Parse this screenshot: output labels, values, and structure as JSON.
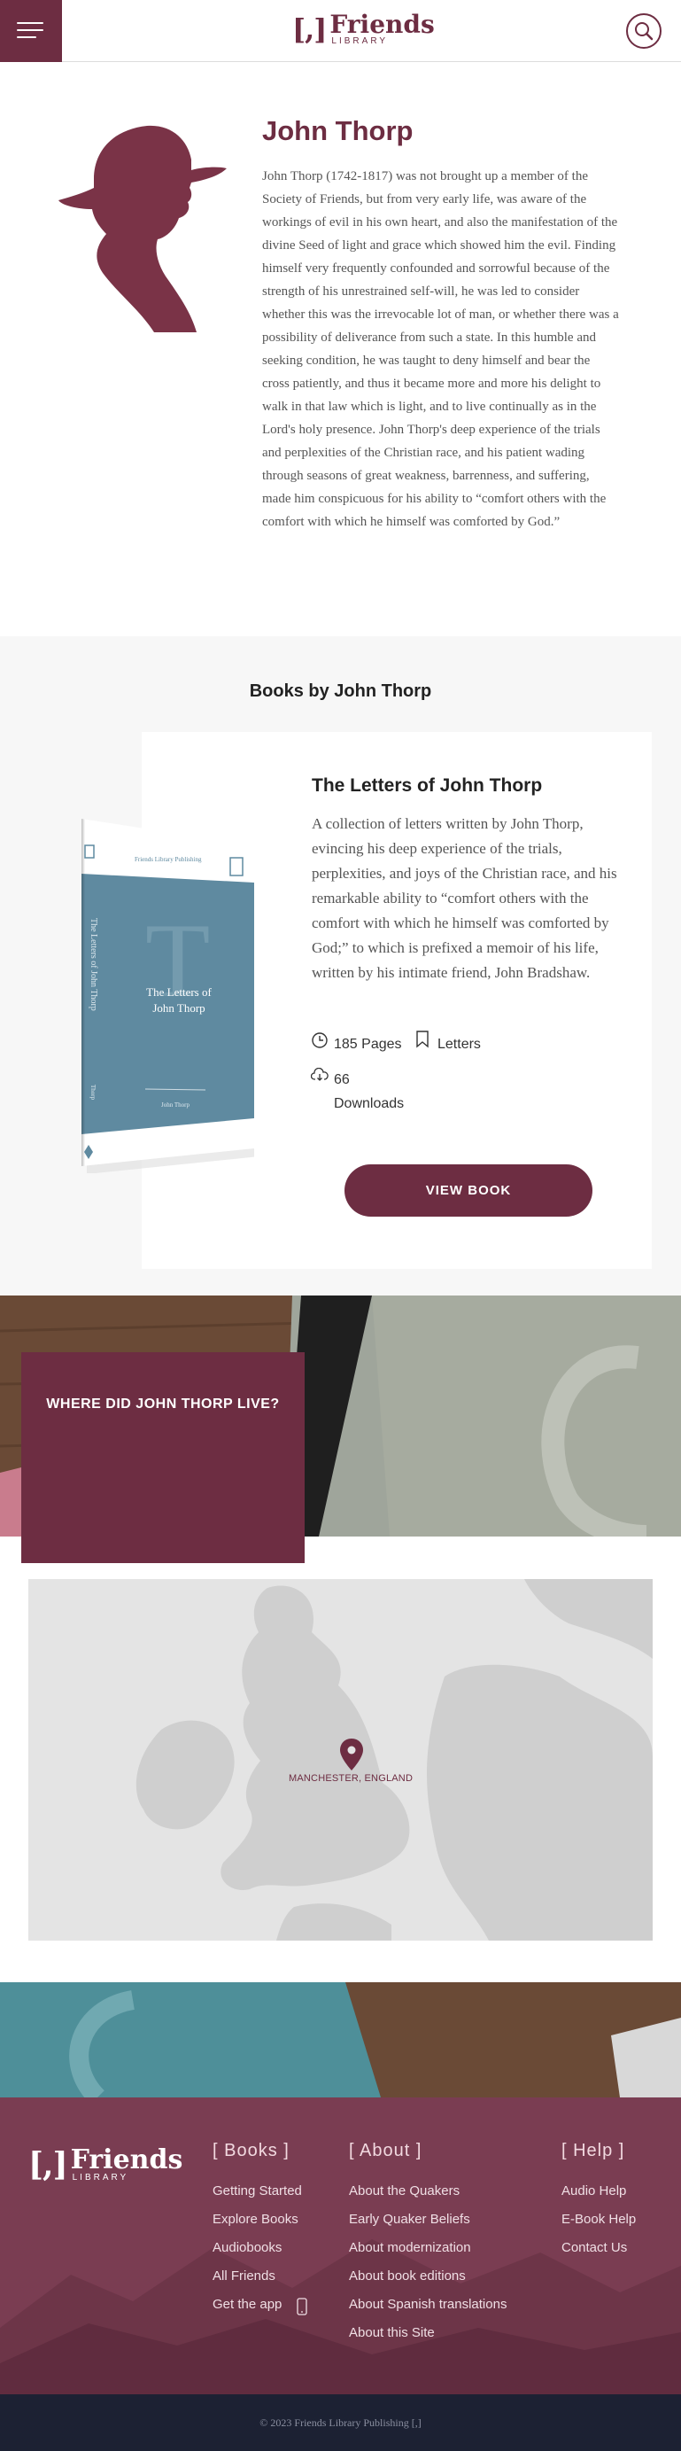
{
  "header": {
    "logo_mark": "[,]",
    "logo_word": "Friends",
    "logo_sub": "LIBRARY",
    "menu_icon": "hamburger-icon",
    "search_icon": "search-icon"
  },
  "author": {
    "name": "John Thorp",
    "bio": "John Thorp (1742-1817) was not brought up a member of the Society of Friends, but from very early life, was aware of the workings of evil in his own heart, and also the manifestation of the divine Seed of light and grace which showed him the evil. Finding himself very frequently confounded and sorrowful because of the strength of his unrestrained self-will, he was led to consider whether this was the irrevocable lot of man, or whether there was a possibility of deliverance from such a state. In this humble and seeking condition, he was taught to deny himself and bear the cross patiently, and thus it became more and more his delight to walk in that law which is light, and to live continually as in the Lord's holy presence. John Thorp's deep experience of the trials and perplexities of the Christian race, and his patient wading through seasons of great weakness, barrenness, and suffering, made him conspicuous for his ability to “comfort others with the comfort with which he himself was comforted by God.”"
  },
  "books": {
    "heading": "Books by John Thorp",
    "items": [
      {
        "title": "The Letters of John Thorp",
        "description": "A collection of letters written by John Thorp, evincing his deep experience of the trials, perplexities, and joys of the Christian race, and his remarkable ability to “comfort others with the comfort with which he himself was comforted by God;” to which is prefixed a memoir of his life, written by his intimate friend, John Bradshaw.",
        "pages": "185 Pages",
        "tag": "Letters",
        "downloads_count": "66",
        "downloads_label": "Downloads",
        "button": "VIEW BOOK",
        "cover": {
          "publisher": "Friends Library Publishing",
          "title_line1": "The Letters of",
          "title_line2": "John Thorp",
          "spine": "The Letters of John Thorp",
          "author": "John Thorp",
          "spine_author": "Thorp",
          "letter": "T",
          "color": "#5f8aa0"
        }
      }
    ]
  },
  "location": {
    "heading": "WHERE DID JOHN THORP LIVE?",
    "place": "MANCHESTER, ENGLAND"
  },
  "footer": {
    "columns": [
      {
        "heading": "[ Books ]",
        "links": [
          "Getting Started",
          "Explore Books",
          "Audiobooks",
          "All Friends",
          "Get the app"
        ]
      },
      {
        "heading": "[ About ]",
        "links": [
          "About the Quakers",
          "Early Quaker Beliefs",
          "About modernization",
          "About book editions",
          "About Spanish translations",
          "About this Site"
        ]
      },
      {
        "heading": "[ Help ]",
        "links": [
          "Audio Help",
          "E-Book Help",
          "Contact Us"
        ]
      }
    ],
    "copyright": "© 2023 Friends Library Publishing [,]"
  },
  "colors": {
    "brand": "#6d2d42",
    "cover": "#5f8aa0",
    "footer_bg": "#1c2133"
  }
}
